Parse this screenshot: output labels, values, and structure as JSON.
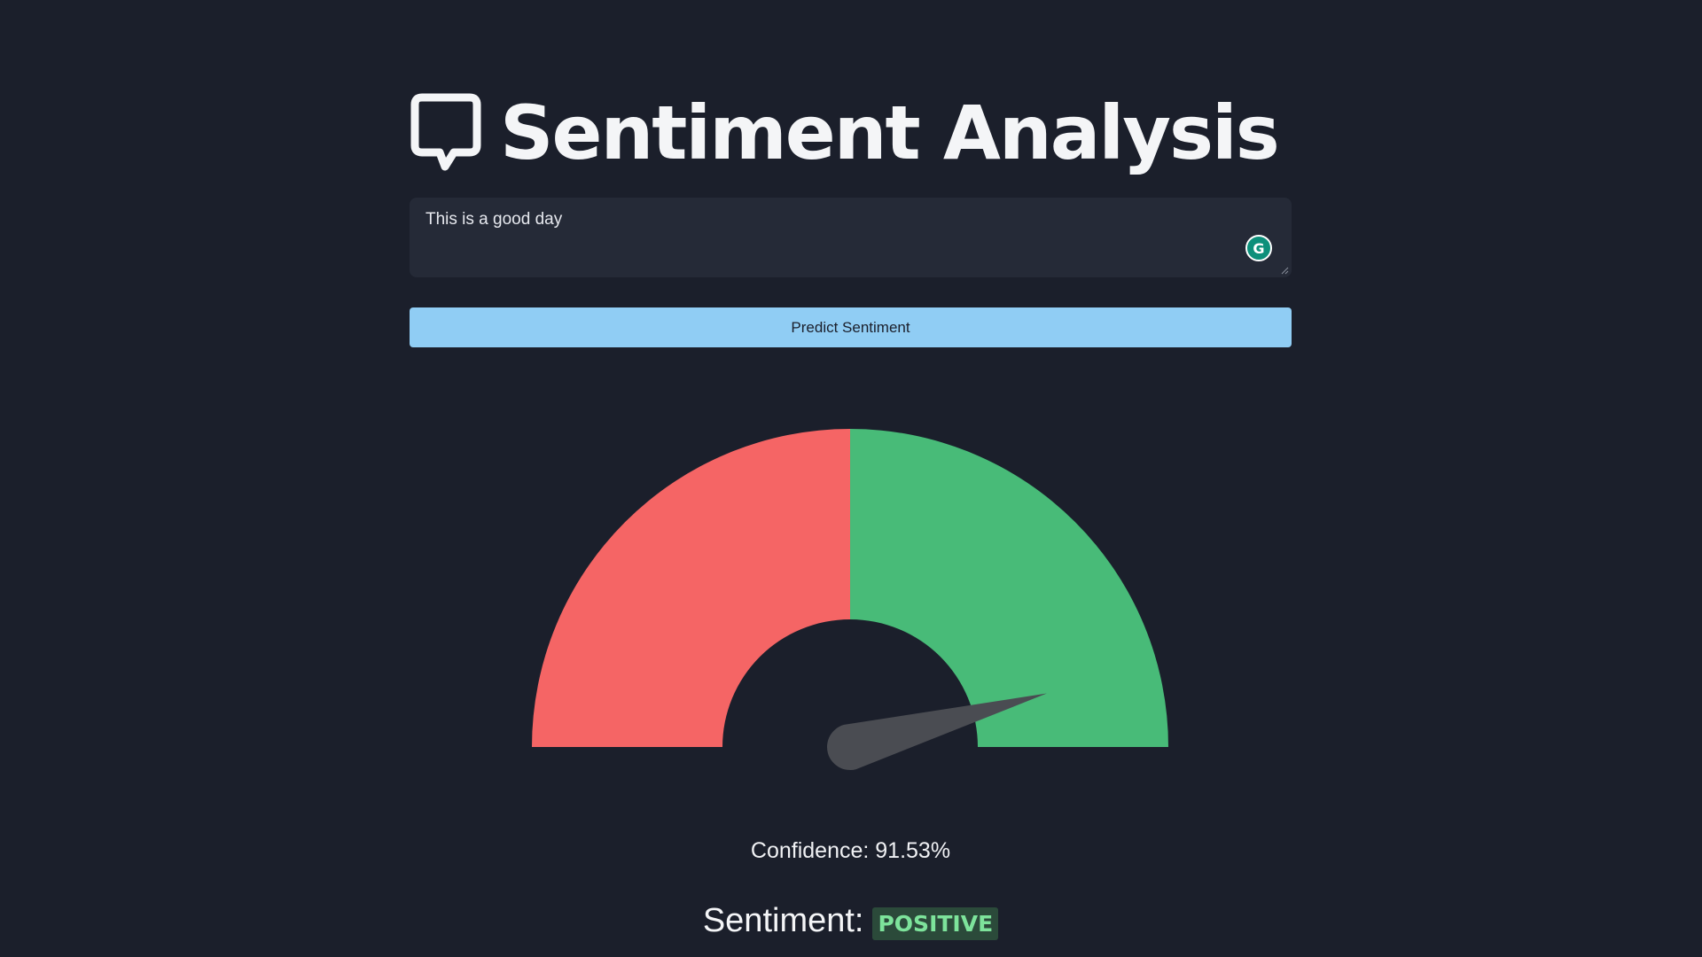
{
  "header": {
    "title": "Sentiment Analysis",
    "icon": "speech-bubble-icon"
  },
  "input": {
    "value": "This is a good day",
    "grammarly_icon": "grammarly-icon"
  },
  "predict_button": {
    "label": "Predict Sentiment"
  },
  "gauge": {
    "negative_color": "#f56565",
    "positive_color": "#48bb78",
    "needle_color": "#4a4c52",
    "needle_value": 0.9153
  },
  "result": {
    "confidence_text": "Confidence: 91.53%",
    "sentiment_label": "Sentiment:",
    "sentiment_value": "POSITIVE"
  },
  "colors": {
    "background": "#1b1f2b",
    "button": "#90cdf4",
    "badge_bg": "#2b4a3a",
    "badge_text": "#7de39b"
  }
}
